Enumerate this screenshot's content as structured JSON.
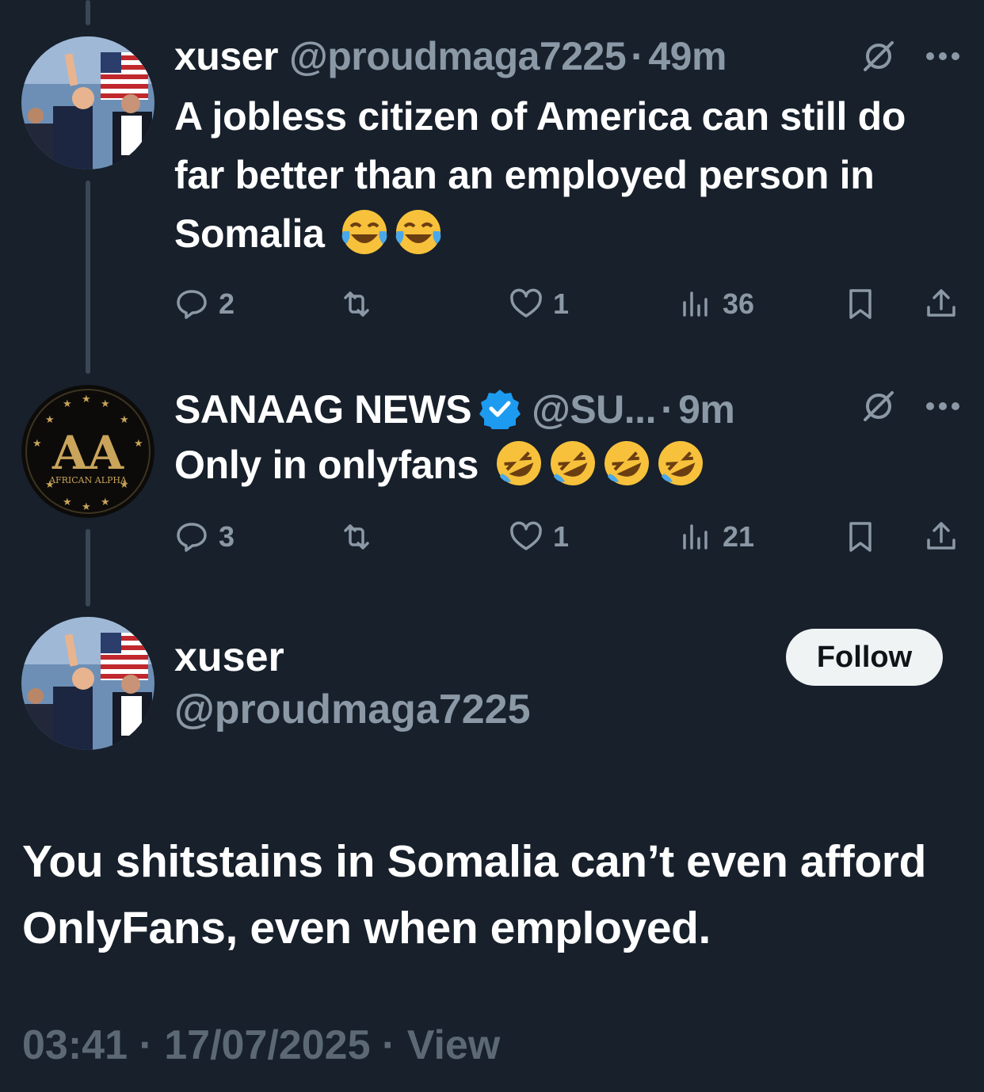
{
  "tweets": [
    {
      "name": "xuser",
      "handle": "@proudmaga7225",
      "time": "49m",
      "text": "A jobless citizen of America can still do far better than an employed person in Somalia",
      "emoji": [
        "face-with-tears-of-joy",
        "face-with-tears-of-joy"
      ],
      "replies": "2",
      "reposts": "",
      "likes": "1",
      "views": "36"
    },
    {
      "name": "SANAAG NEWS",
      "verified": true,
      "handle": "@SU...",
      "time": "9m",
      "text": "Only in onlyfans",
      "emoji": [
        "rolling-on-floor-laughing",
        "rolling-on-floor-laughing",
        "rolling-on-floor-laughing",
        "rolling-on-floor-laughing"
      ],
      "avatar_text": "AA",
      "avatar_subtext": "AFRICAN ALPHA",
      "replies": "3",
      "reposts": "",
      "likes": "1",
      "views": "21"
    }
  ],
  "main": {
    "name": "xuser",
    "handle": "@proudmaga7225",
    "follow_label": "Follow",
    "text": "You shitstains in Somalia can’t even afford OnlyFans, even when employed.",
    "time": "03:41",
    "date": "17/07/2025",
    "view_label": "View"
  },
  "sep": "·",
  "colors": {
    "background": "#17202b",
    "muted": "#8b98a5",
    "verified": "#1d9bf0",
    "follow_bg": "#eff3f4"
  }
}
